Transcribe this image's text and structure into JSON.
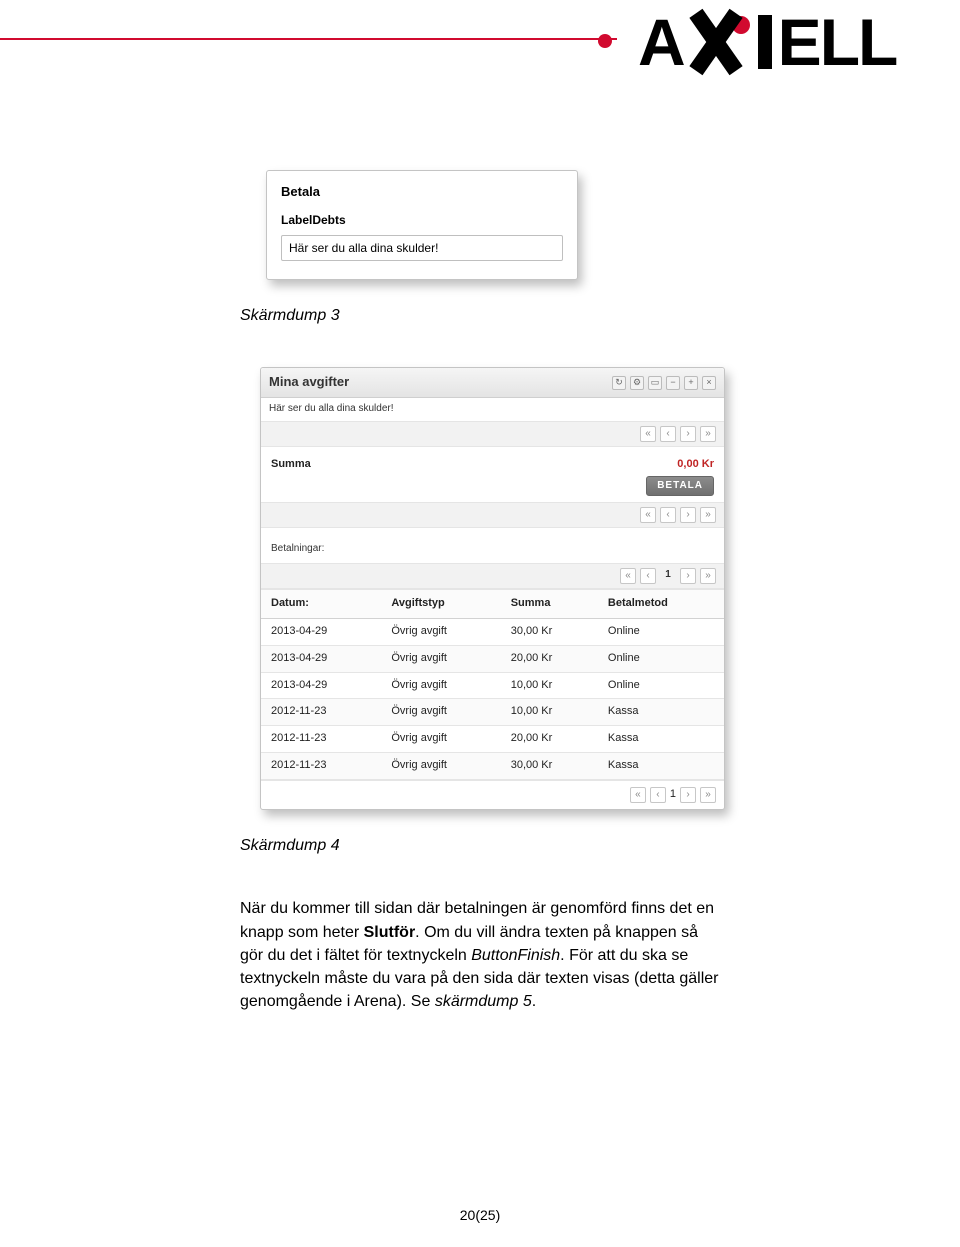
{
  "brand": {
    "name": "AXIELL"
  },
  "screenshot3": {
    "title": "Betala",
    "label": "LabelDebts",
    "input_value": "Här ser du alla dina skulder!"
  },
  "caption3": "Skärmdump 3",
  "screenshot4": {
    "title": "Mina avgifter",
    "subheader": "Här ser du alla dina skulder!",
    "summa_label": "Summa",
    "summa_amount": "0,00 Kr",
    "pay_button": "BETALA",
    "payments_label": "Betalningar:",
    "page_number": "1",
    "headers": {
      "date": "Datum:",
      "type": "Avgiftstyp",
      "amount": "Summa",
      "method": "Betalmetod"
    },
    "rows": [
      {
        "date": "2013-04-29",
        "type": "Övrig avgift",
        "amount": "30,00 Kr",
        "method": "Online"
      },
      {
        "date": "2013-04-29",
        "type": "Övrig avgift",
        "amount": "20,00 Kr",
        "method": "Online"
      },
      {
        "date": "2013-04-29",
        "type": "Övrig avgift",
        "amount": "10,00 Kr",
        "method": "Online"
      },
      {
        "date": "2012-11-23",
        "type": "Övrig avgift",
        "amount": "10,00 Kr",
        "method": "Kassa"
      },
      {
        "date": "2012-11-23",
        "type": "Övrig avgift",
        "amount": "20,00 Kr",
        "method": "Kassa"
      },
      {
        "date": "2012-11-23",
        "type": "Övrig avgift",
        "amount": "30,00 Kr",
        "method": "Kassa"
      }
    ]
  },
  "caption4": "Skärmdump 4",
  "paragraph": {
    "t1": "När du kommer till sidan där betalningen är genomförd finns det en knapp som heter ",
    "bold1": "Slutför",
    "t2": ". Om du vill ändra texten på knappen så gör du det i fältet för textnyckeln ",
    "ital1": "ButtonFinish",
    "t3": ". För att du ska se textnyckeln måste du vara på den sida där texten visas (detta gäller genomgående i Arena). Se ",
    "ital2": "skärmdump 5",
    "t4": "."
  },
  "footer": "20(25)"
}
